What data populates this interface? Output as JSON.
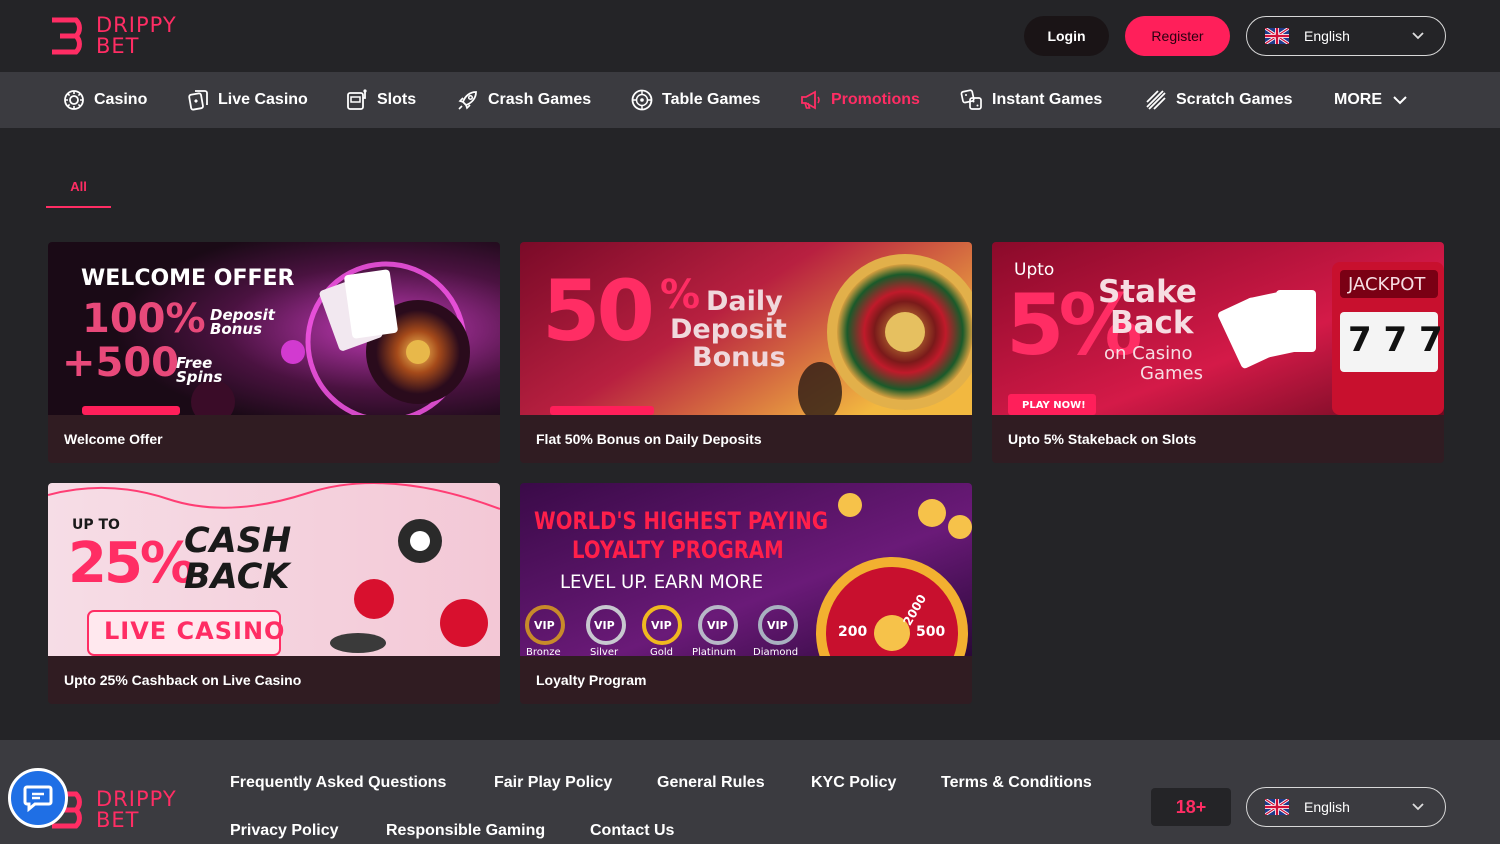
{
  "brand": {
    "line1": "DRIPPY",
    "line2": "BET"
  },
  "header": {
    "login": "Login",
    "register": "Register",
    "language": "English"
  },
  "nav": [
    {
      "label": "Casino",
      "icon": "casino-chip-icon"
    },
    {
      "label": "Live Casino",
      "icon": "live-casino-icon"
    },
    {
      "label": "Slots",
      "icon": "slot-machine-icon"
    },
    {
      "label": "Crash Games",
      "icon": "rocket-icon"
    },
    {
      "label": "Table Games",
      "icon": "roulette-icon"
    },
    {
      "label": "Promotions",
      "icon": "megaphone-icon"
    },
    {
      "label": "Instant Games",
      "icon": "dice-icon"
    },
    {
      "label": "Scratch Games",
      "icon": "scratch-icon"
    },
    {
      "label": "MORE",
      "icon": "chevron-down-icon"
    }
  ],
  "filter": {
    "all": "All"
  },
  "promotions": [
    {
      "title": "Welcome Offer",
      "art": {
        "line1": "WELCOME OFFER",
        "big1": "100%",
        "small1a": "Deposit",
        "small1b": "Bonus",
        "big2": "+500",
        "small2a": "Free",
        "small2b": "Spins"
      }
    },
    {
      "title": "Flat 50% Bonus on Daily Deposits",
      "art": {
        "big": "50",
        "pct": "%",
        "l1": "Daily",
        "l2": "Deposit",
        "l3": "Bonus"
      }
    },
    {
      "title": "Upto 5% Stakeback on Slots",
      "art": {
        "upto": "Upto",
        "big": "5%",
        "l1": "Stake",
        "l2": "Back",
        "l3": "on Casino",
        "l4": "Games",
        "cta": "PLAY NOW!",
        "jackpot": "JACKPOT",
        "reels": "7 7 7"
      }
    },
    {
      "title": "Upto 25% Cashback on Live Casino",
      "art": {
        "upto": "UP TO",
        "big": "25%",
        "l1": "CASH",
        "l2": "BACK",
        "badge": "LIVE CASINO"
      }
    },
    {
      "title": "Loyalty Program",
      "art": {
        "l1": "WORLD'S HIGHEST PAYING",
        "l2": "LOYALTY PROGRAM",
        "l3": "LEVEL UP. EARN MORE",
        "tiers": [
          "Bronze",
          "Silver",
          "Gold",
          "Platinum",
          "Diamond"
        ],
        "vip": "VIP",
        "wheel": [
          "200",
          "500",
          "2000"
        ]
      }
    }
  ],
  "footer": {
    "links_row1": [
      "Frequently Asked Questions",
      "Fair Play Policy",
      "General Rules",
      "KYC Policy",
      "Terms & Conditions"
    ],
    "links_row2": [
      "Privacy Policy",
      "Responsible Gaming",
      "Contact Us"
    ],
    "age": "18+",
    "language": "English"
  },
  "colors": {
    "accent": "#ff2d64",
    "nav_bg": "#3b3b40",
    "page_bg": "#242427",
    "chat": "#1f6fe5"
  }
}
